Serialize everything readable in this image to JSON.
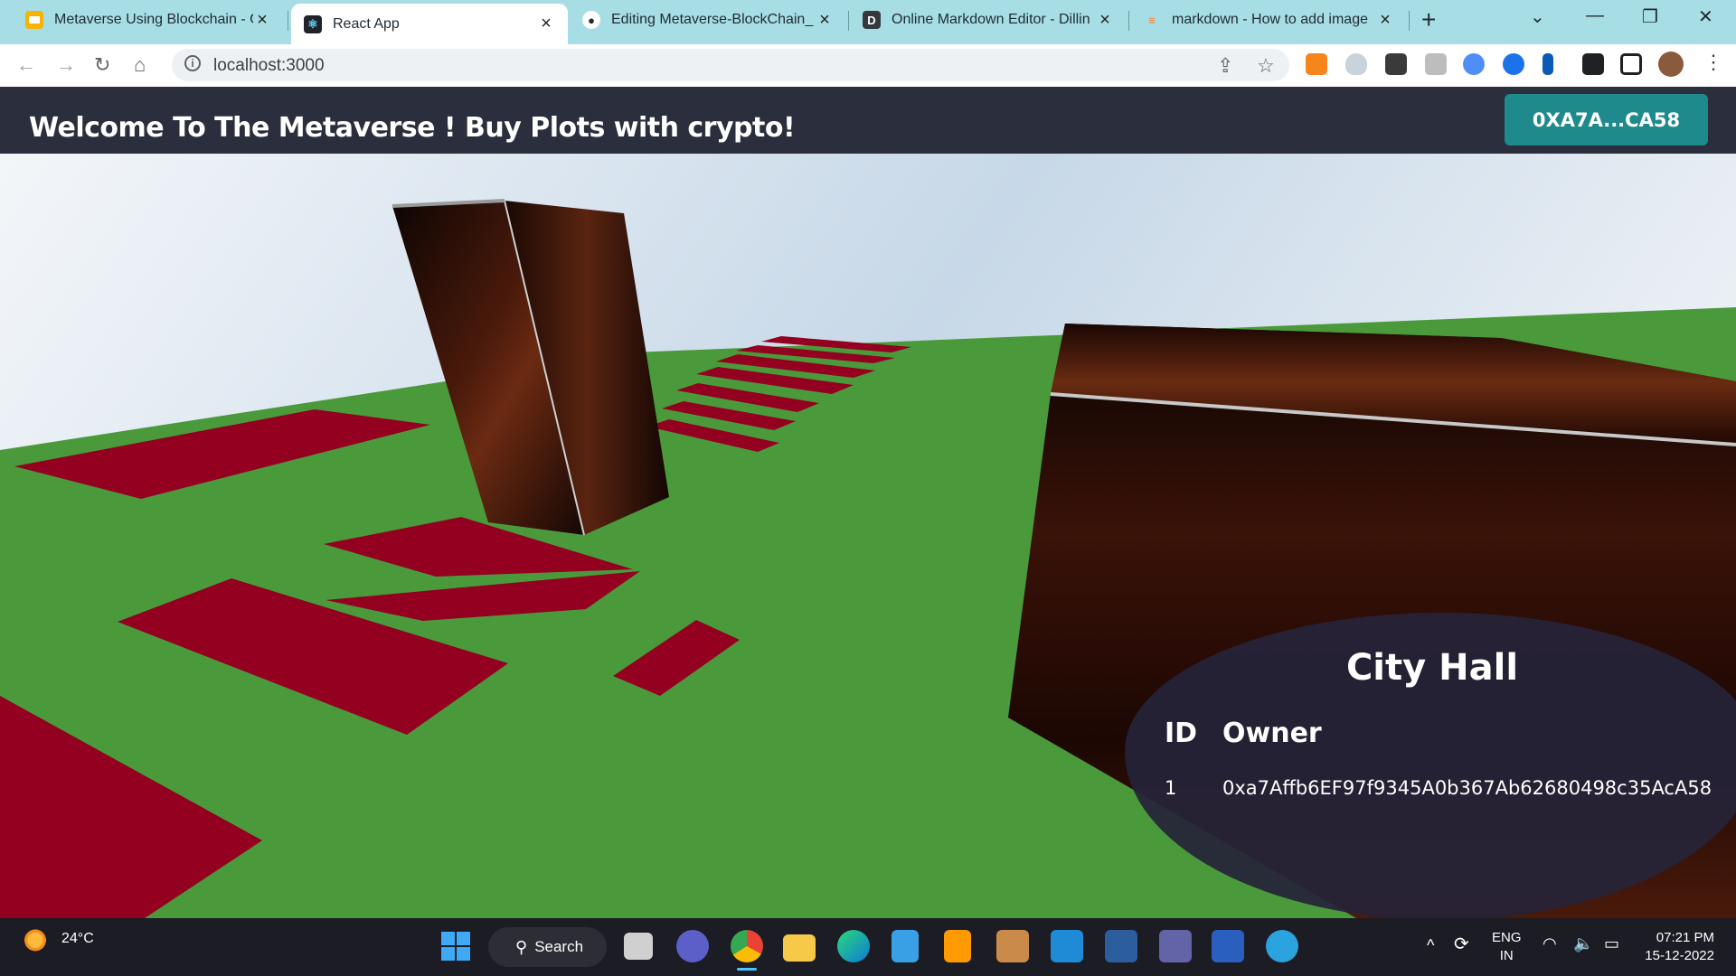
{
  "browser": {
    "tabs": [
      {
        "title": "Metaverse Using Blockchain - G",
        "icon": "slides-icon",
        "active": false
      },
      {
        "title": "React App",
        "icon": "react-icon",
        "active": true
      },
      {
        "title": "Editing Metaverse-BlockChain_",
        "icon": "github-icon",
        "active": false
      },
      {
        "title": "Online Markdown Editor - Dillin",
        "icon": "dillinger-icon",
        "active": false
      },
      {
        "title": "markdown - How to add image",
        "icon": "stackoverflow-icon",
        "active": false
      }
    ],
    "url": "localhost:3000"
  },
  "app": {
    "title": "Welcome To The Metaverse ! Buy Plots with crypto!",
    "wallet_button": "0XA7A...CA58",
    "accent": "#1f8a8c"
  },
  "panel": {
    "title": "City Hall",
    "columns": [
      "ID",
      "Owner"
    ],
    "rows": [
      {
        "id": "1",
        "owner": "0xa7Affb6EF97f9345A0b367Ab62680498c35AcA58"
      }
    ]
  },
  "scene_colors": {
    "ground": "#4a9a3c",
    "plot": "#930020",
    "building": "#2a0d06"
  },
  "taskbar": {
    "weather": "24°C",
    "search_label": "Search",
    "lang_line1": "ENG",
    "lang_line2": "IN",
    "time": "07:21 PM",
    "date": "15-12-2022"
  }
}
